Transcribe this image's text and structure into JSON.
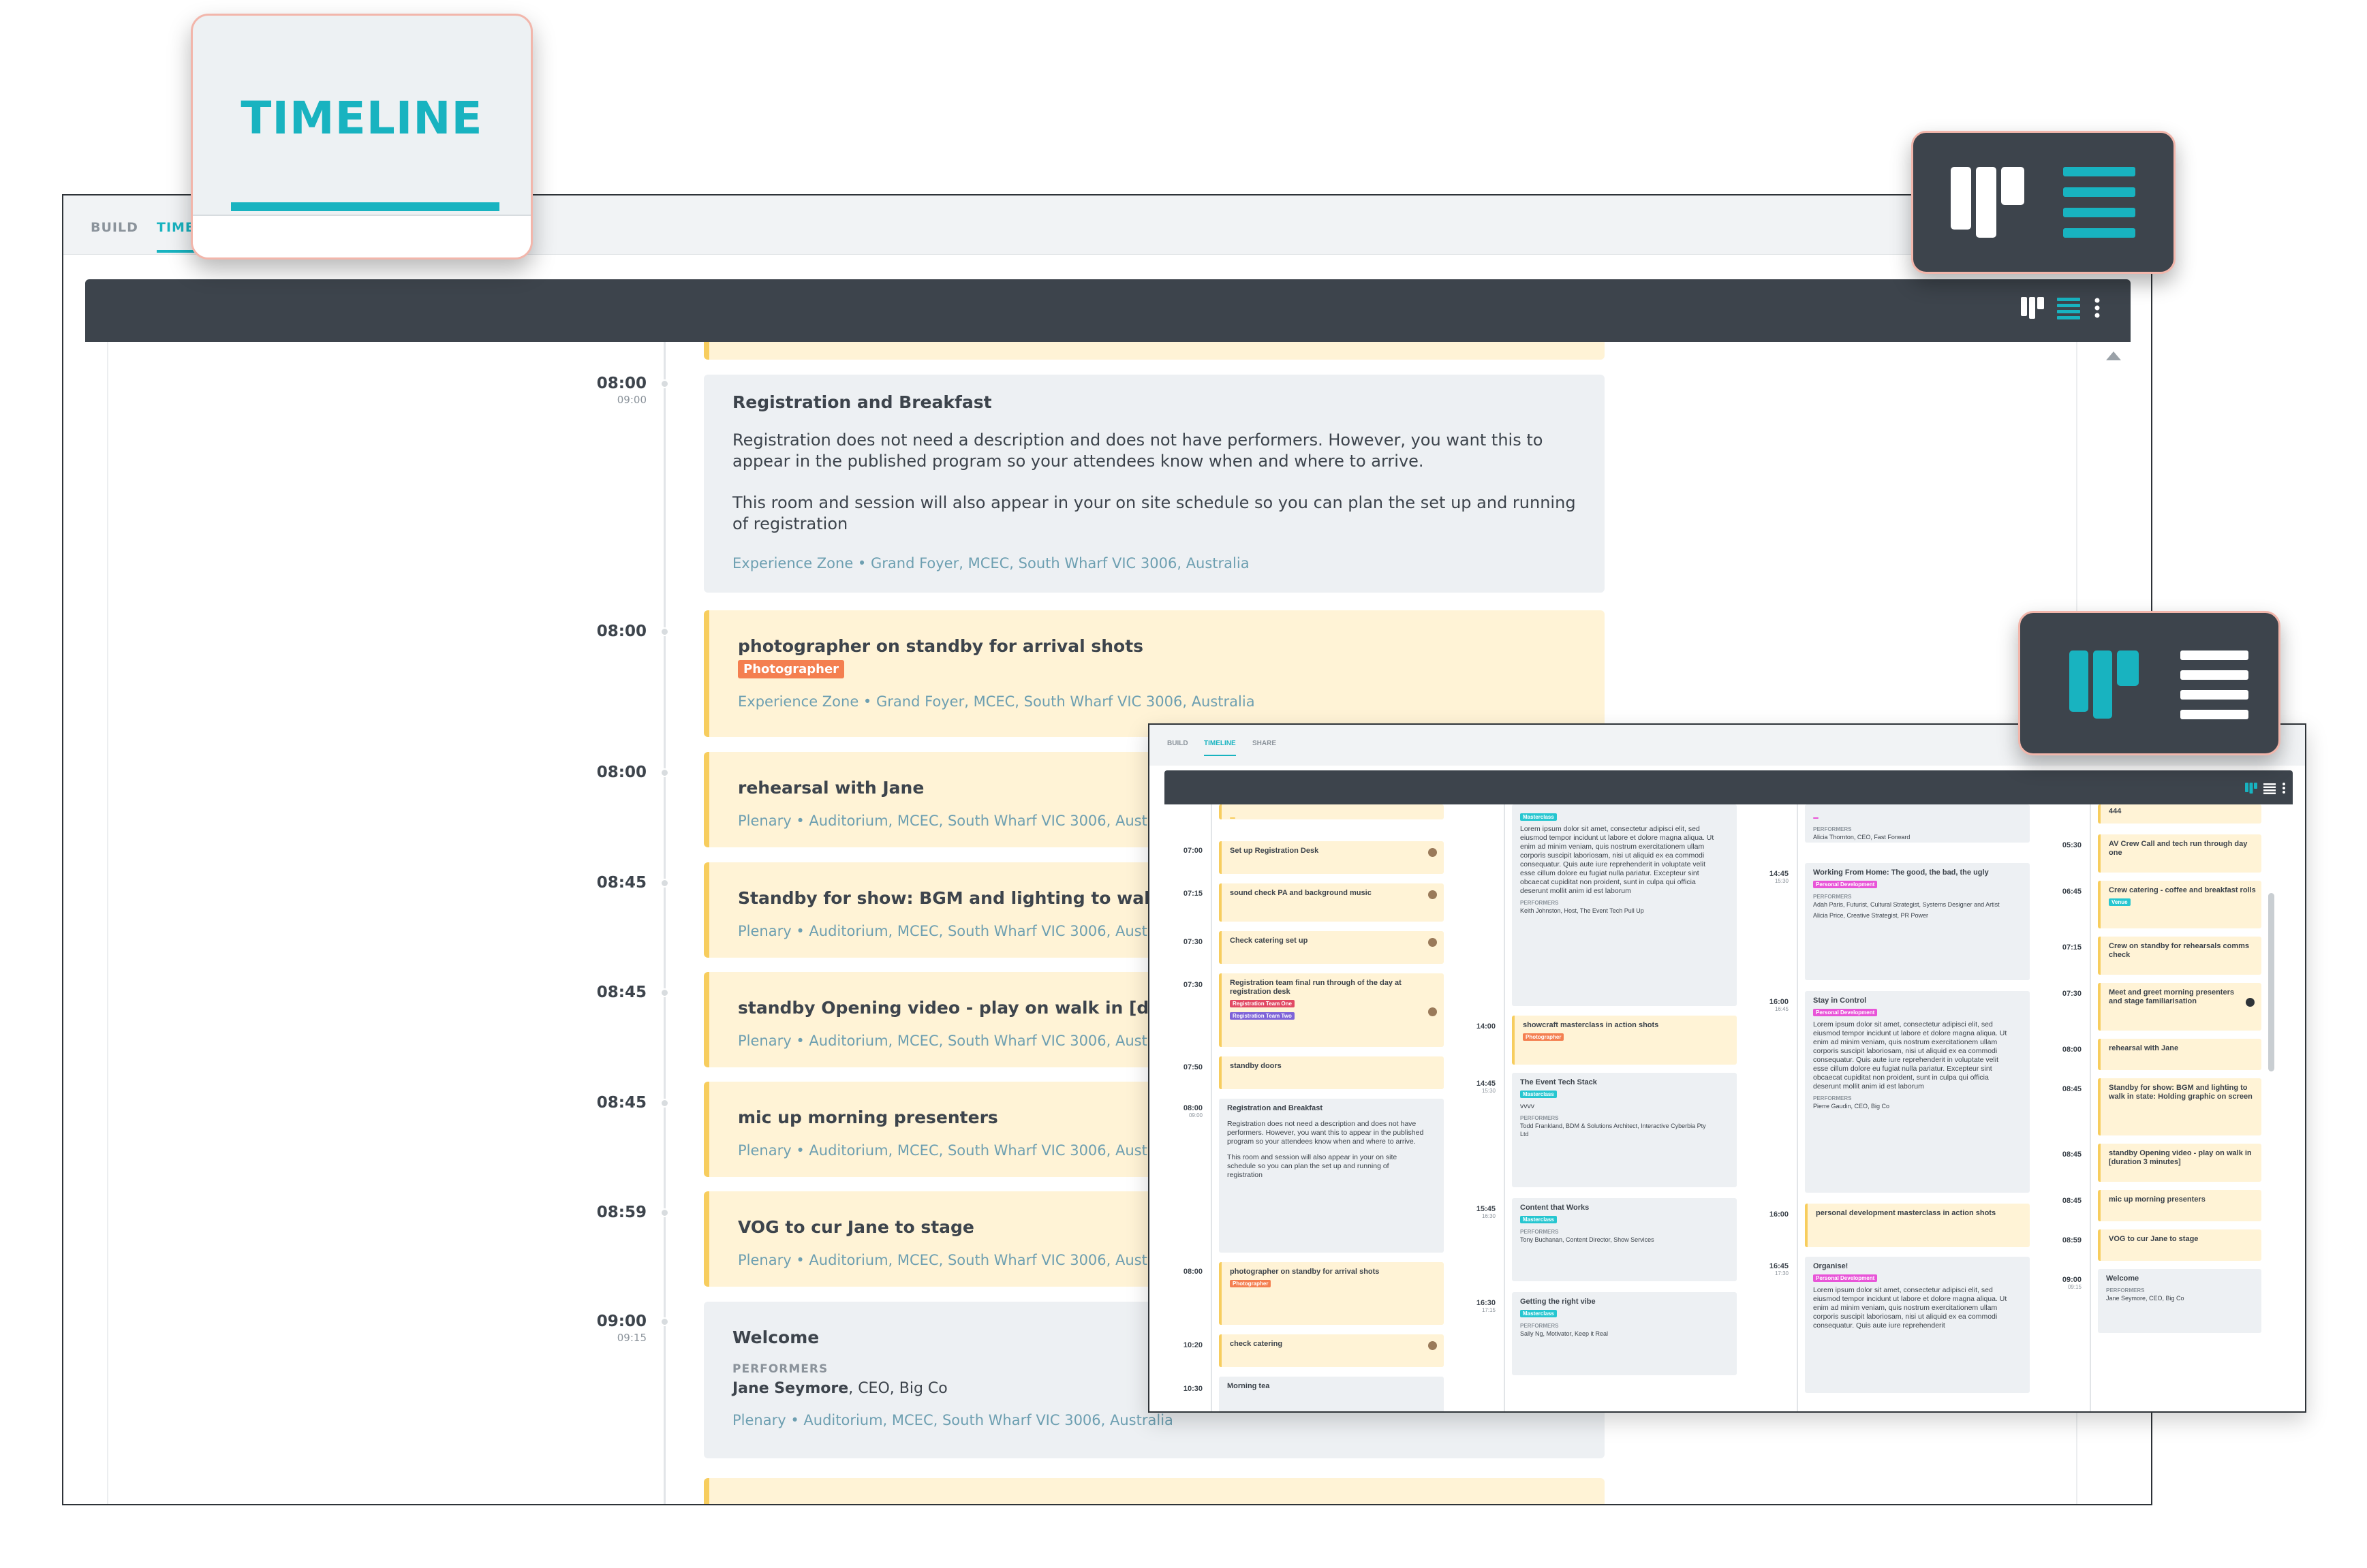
{
  "tabs": {
    "build": "BUILD",
    "timeline": "TIME"
  },
  "callout": {
    "label": "TIMELINE"
  },
  "colors": {
    "accent": "#18b3c0",
    "bar": "#3d444c",
    "card_yellow": "#fff3d6",
    "card_grey": "#edf0f3",
    "callout_border": "#f2b6ab"
  },
  "toolbar_icons": [
    "board-view-icon",
    "list-view-icon",
    "more-vertical-icon"
  ],
  "events": [
    {
      "time": "08:00",
      "end": "09:00",
      "style": "grey",
      "title": "Registration and Breakfast",
      "desc1": "Registration does not need a description and does not have performers. However, you want this to appear in the published program so your attendees know when and where to arrive.",
      "desc2": "This room and session will also appear in your on site schedule so you can plan the set up and running of registration",
      "location": "Experience Zone • Grand Foyer, MCEC, South Wharf VIC 3006, Australia"
    },
    {
      "time": "08:00",
      "style": "yellow",
      "title": "photographer on standby for arrival shots",
      "tag": "Photographer",
      "location": "Experience Zone • Grand Foyer, MCEC, South Wharf VIC 3006, Australia"
    },
    {
      "time": "08:00",
      "style": "yellow",
      "title": "rehearsal with Jane",
      "location": "Plenary • Auditorium, MCEC, South Wharf VIC 3006, Australia"
    },
    {
      "time": "08:45",
      "style": "yellow",
      "title": "Standby for show: BGM and lighting to walk in state: H",
      "location": "Plenary • Auditorium, MCEC, South Wharf VIC 3006, Australia"
    },
    {
      "time": "08:45",
      "style": "yellow",
      "title": "standby Opening video - play on walk in [duration 3 m",
      "location": "Plenary • Auditorium, MCEC, South Wharf VIC 3006, Australia"
    },
    {
      "time": "08:45",
      "style": "yellow",
      "title": "mic up morning presenters",
      "location": "Plenary • Auditorium, MCEC, South Wharf VIC 3006, Australia"
    },
    {
      "time": "08:59",
      "style": "yellow",
      "title": "VOG to cur Jane to stage",
      "location": "Plenary • Auditorium, MCEC, South Wharf VIC 3006, Australia"
    },
    {
      "time": "09:00",
      "end": "09:15",
      "style": "grey",
      "title": "Welcome",
      "performers_heading": "PERFORMERS",
      "performer_name": "Jane Seymore",
      "performer_role": ", CEO, Big Co",
      "location": "Plenary • Auditorium, MCEC, South Wharf VIC 3006, Australia"
    }
  ],
  "inset": {
    "tabs": {
      "build": "BUILD",
      "timeline": "TIMELINE",
      "share": "SHARE"
    },
    "col1": [
      {
        "time": "07:00",
        "title": "Set up Registration Desk"
      },
      {
        "time": "07:15",
        "title": "sound check PA and background music"
      },
      {
        "time": "07:30",
        "title": "Check catering set up"
      },
      {
        "time": "07:30",
        "title": "Registration team final run through of the day at registration desk",
        "tag1": "Registration Team One",
        "tag2": "Registration Team Two"
      },
      {
        "time": "07:50",
        "title": "standby doors"
      },
      {
        "time": "08:00",
        "end": "09:00",
        "title": "Registration and Breakfast",
        "text": "Registration does not need a description and does not have performers. However, you want this to appear in the published program so your attendees know when and where to arrive.",
        "text2": "This room and session will also appear in your on site schedule so you can plan the set up and running of registration"
      },
      {
        "time": "08:00",
        "title": "photographer on standby for arrival shots",
        "tag": "Photographer"
      },
      {
        "time": "10:20",
        "title": "check catering"
      },
      {
        "time": "10:30",
        "title": "Morning tea"
      }
    ],
    "col2": [
      {
        "tag": "Masterclass",
        "text": "Lorem ipsum dolor sit amet, consectetur adipisci elit, sed eiusmod tempor incidunt ut labore et dolore magna aliqua. Ut enim ad minim veniam, quis nostrum exercitationem ullam corporis suscipit laboriosam, nisi ut aliquid ex ea commodi consequatur. Quis aute iure reprehenderit in voluptate velit esse cillum dolore eu fugiat nulla pariatur. Excepteur sint obcaecat cupiditat non proident, sunt in culpa qui officia deserunt mollit anim id est laborum",
        "ph": "PERFORMERS",
        "perf": "Keith Johnston, Host, The Event Tech Pull Up"
      },
      {
        "time": "14:00",
        "title": "showcraft masterclass in action shots",
        "tag": "Photographer"
      },
      {
        "time": "14:45",
        "end": "15:30",
        "title": "The Event Tech Stack",
        "tag": "Masterclass",
        "text": "vvvv",
        "ph": "PERFORMERS",
        "perf": "Todd Frankland, BDM & Solutions Architect, Interactive Cyberbia Pty Ltd"
      },
      {
        "time": "15:45",
        "end": "16:30",
        "title": "Content that Works",
        "tag": "Masterclass",
        "ph": "PERFORMERS",
        "perf": "Tony Buchanan, Content Director, Show Services"
      },
      {
        "time": "16:30",
        "end": "17:15",
        "title": "Getting the right vibe",
        "tag": "Masterclass",
        "ph": "PERFORMERS",
        "perf": "Sally Ng, Motivator, Keep it Real"
      }
    ],
    "col3": [
      {
        "ph": "PERFORMERS",
        "perf": "Alicia Thornton, CEO, Fast Forward"
      },
      {
        "time": "14:45",
        "end": "15:30",
        "title": "Working From Home: The good, the bad, the ugly",
        "tag": "Personal Development",
        "ph": "PERFORMERS",
        "perf": "Adah Paris, Futurist, Cultural Strategist, Systems Designer and Artist",
        "perf2": "Alicia Price, Creative Strategist, PR Power"
      },
      {
        "time": "16:00",
        "end": "16:45",
        "title": "Stay in Control",
        "tag": "Personal Development",
        "text": "Lorem ipsum dolor sit amet, consectetur adipisci elit, sed eiusmod tempor incidunt ut labore et dolore magna aliqua. Ut enim ad minim veniam, quis nostrum exercitationem ullam corporis suscipit laboriosam, nisi ut aliquid ex ea commodi consequatur. Quis aute iure reprehenderit in voluptate velit esse cillum dolore eu fugiat nulla pariatur. Excepteur sint obcaecat cupiditat non proident, sunt in culpa qui officia deserunt mollit anim id est laborum",
        "ph": "PERFORMERS",
        "perf": "Pierre Gaudin, CEO, Big Co"
      },
      {
        "time": "16:00",
        "title": "personal development masterclass in action shots"
      },
      {
        "time": "16:45",
        "end": "17:30",
        "title": "Organise!",
        "tag": "Personal Development",
        "text": "Lorem ipsum dolor sit amet, consectetur adipisci elit, sed eiusmod tempor incidunt ut labore et dolore magna aliqua. Ut enim ad minim veniam, quis nostrum exercitationem ullam corporis suscipit laboriosam, nisi ut aliquid ex ea commodi consequatur. Quis aute iure reprehenderit"
      }
    ],
    "col4": [
      {
        "title": "444"
      },
      {
        "time": "05:30",
        "title": "AV Crew Call and tech run through day one"
      },
      {
        "time": "06:45",
        "title": "Crew catering - coffee and breakfast rolls",
        "tag": "Venue"
      },
      {
        "time": "07:15",
        "title": "Crew on standby for rehearsals comms check"
      },
      {
        "time": "07:30",
        "title": "Meet and greet morning presenters and stage familiarisation"
      },
      {
        "time": "08:00",
        "title": "rehearsal with Jane"
      },
      {
        "time": "08:45",
        "title": "Standby for show: BGM and lighting to walk in state: Holding graphic on screen"
      },
      {
        "time": "08:45",
        "title": "standby Opening video - play on walk in [duration 3 minutes]"
      },
      {
        "time": "08:45",
        "title": "mic up morning presenters"
      },
      {
        "time": "08:59",
        "title": "VOG to cur Jane to stage"
      },
      {
        "time": "09:00",
        "end": "09:15",
        "title": "Welcome",
        "ph": "PERFORMERS",
        "perf": "Jane Seymore, CEO, Big Co"
      }
    ]
  }
}
